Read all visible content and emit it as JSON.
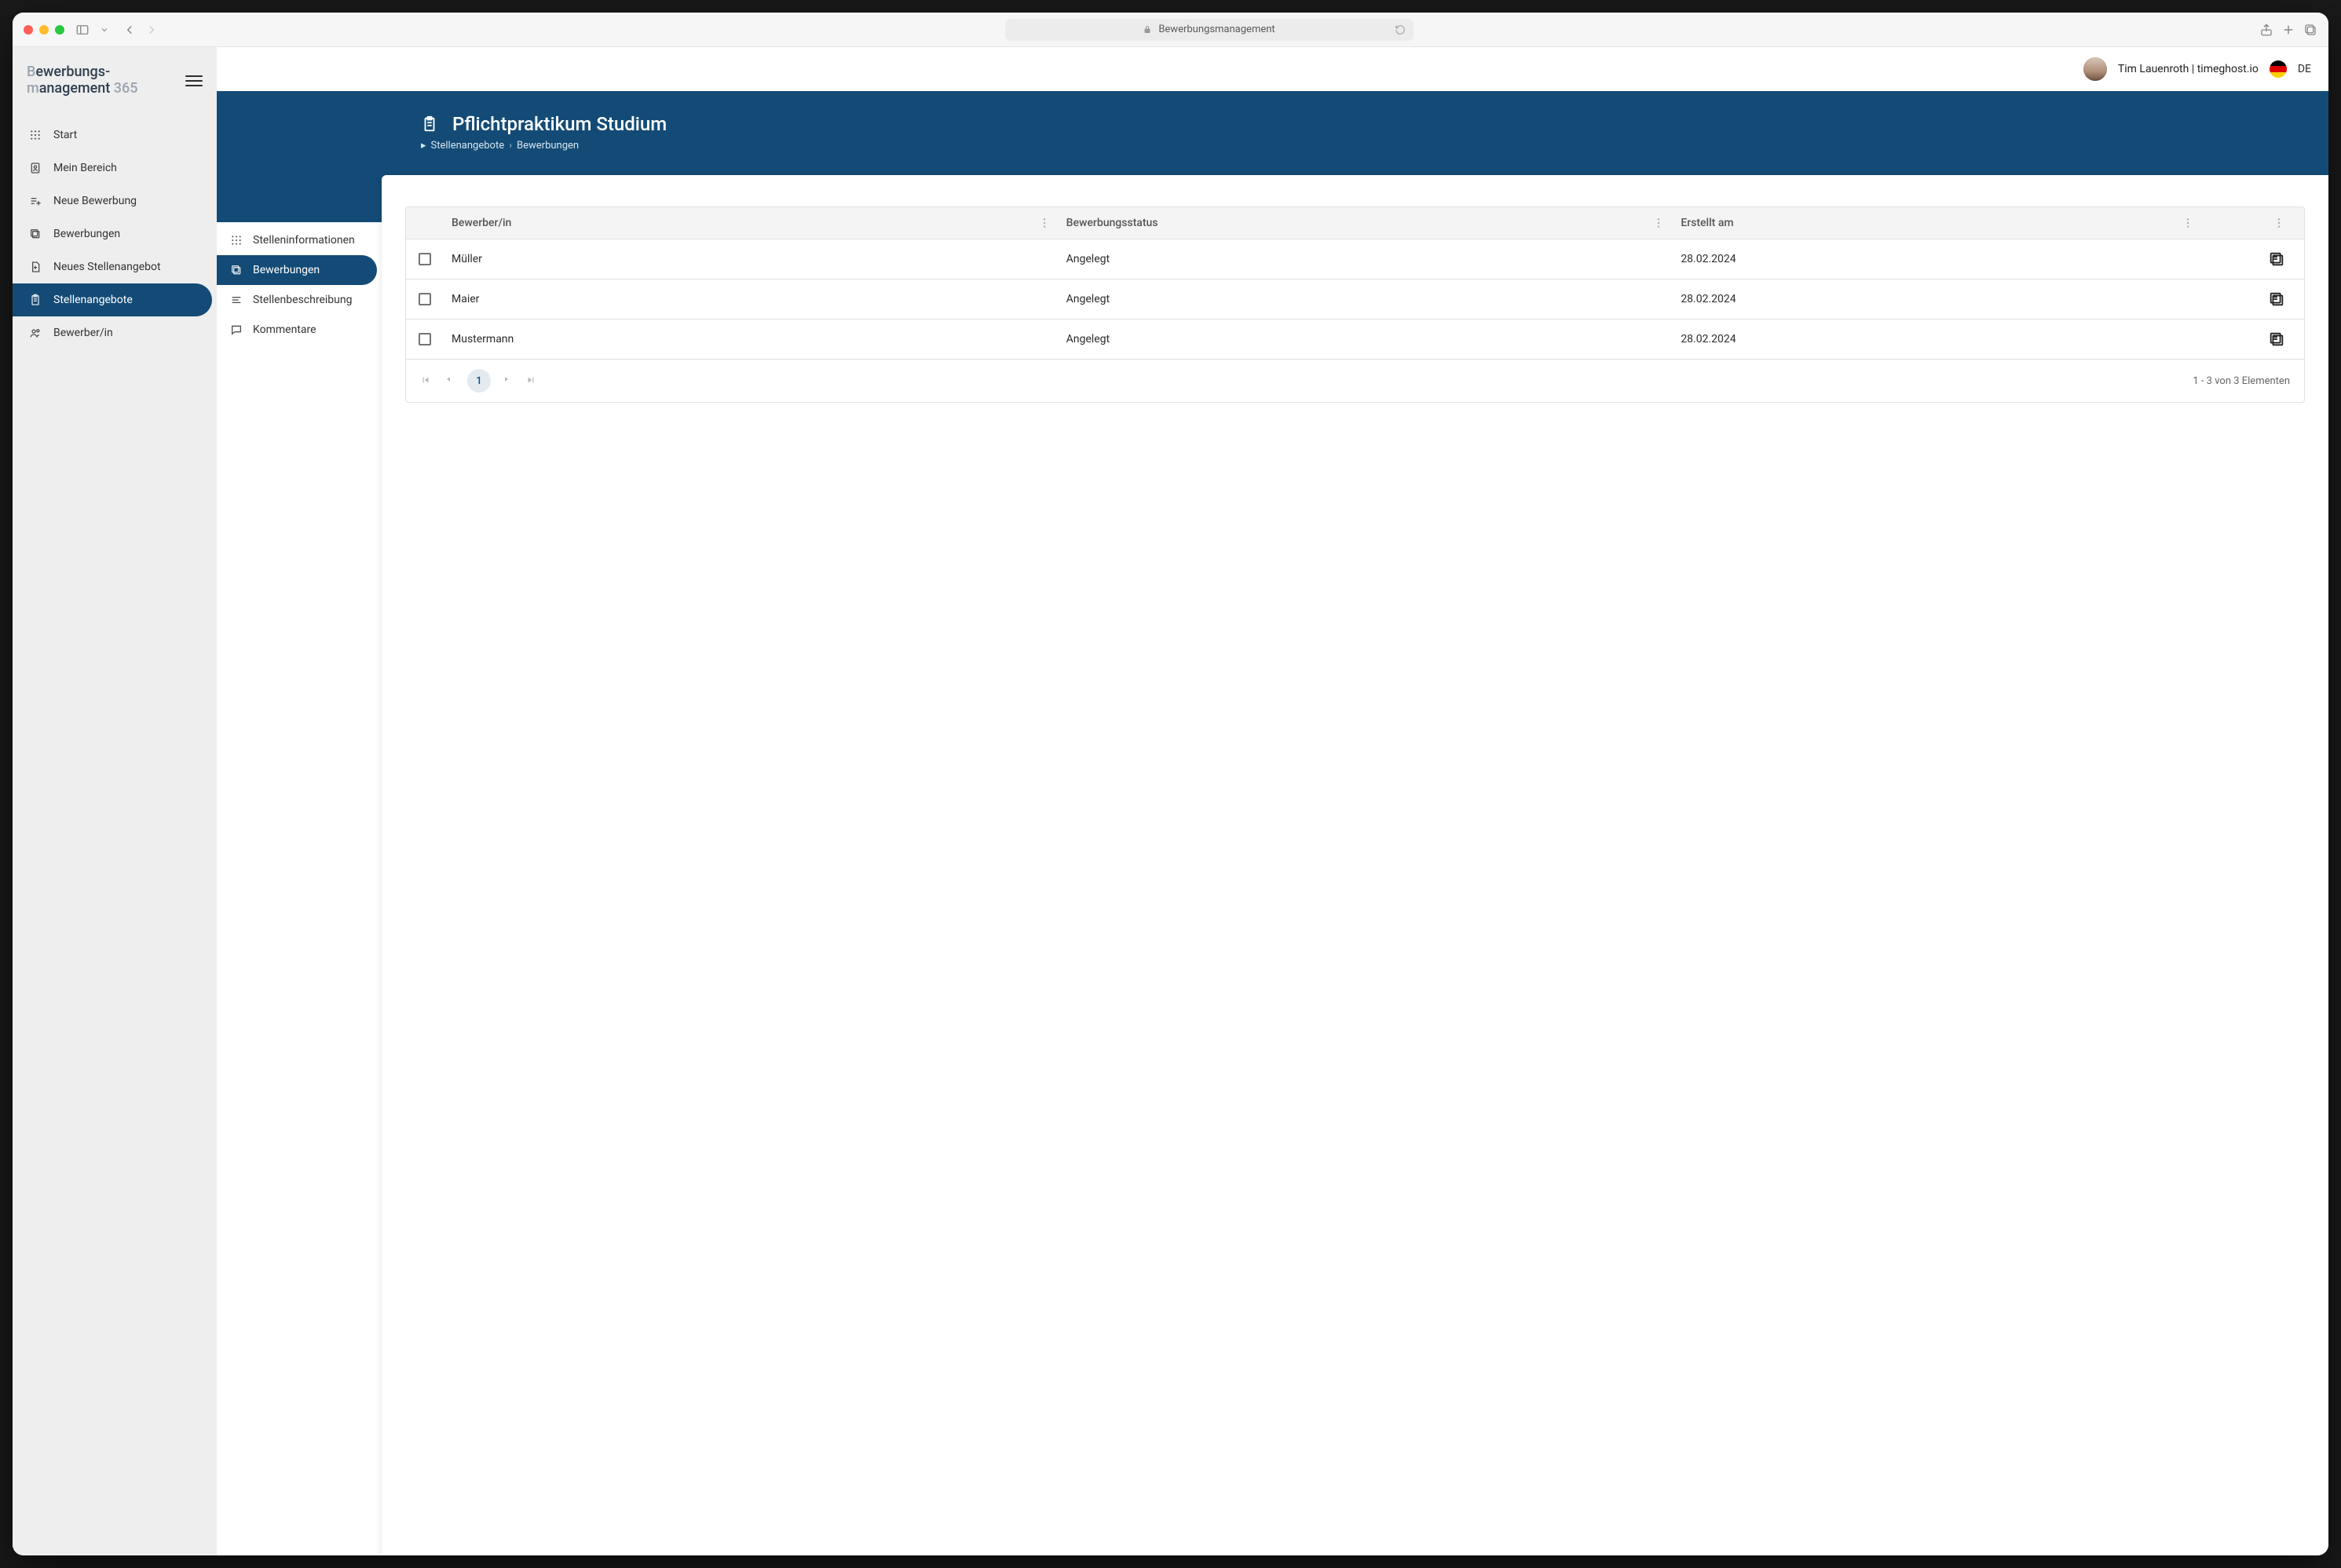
{
  "browser": {
    "url_label": "Bewerbungsmanagement"
  },
  "brand": {
    "line1_prefix_faded": "B",
    "line1_rest": "ewerbungs-",
    "line2_prefix_faded": "m",
    "line2_rest": "anagement",
    "suffix_faded": " 365"
  },
  "user": {
    "label": "Tim Lauenroth | timeghost.io",
    "locale_code": "DE"
  },
  "sidebar": {
    "items": [
      {
        "label": "Start"
      },
      {
        "label": "Mein Bereich"
      },
      {
        "label": "Neue Bewerbung"
      },
      {
        "label": "Bewerbungen"
      },
      {
        "label": "Neues Stellenangebot"
      },
      {
        "label": "Stellenangebote"
      },
      {
        "label": "Bewerber/in"
      }
    ]
  },
  "hero": {
    "title": "Pflichtpraktikum Studium",
    "breadcrumb": [
      "Stellenangebote",
      "Bewerbungen"
    ]
  },
  "subnav": {
    "items": [
      {
        "label": "Stelleninformationen"
      },
      {
        "label": "Bewerbungen"
      },
      {
        "label": "Stellenbeschreibung"
      },
      {
        "label": "Kommentare"
      }
    ]
  },
  "table": {
    "columns": {
      "name": "Bewerber/in",
      "status": "Bewerbungsstatus",
      "date": "Erstellt am"
    },
    "rows": [
      {
        "name": "Müller",
        "status": "Angelegt",
        "date": "28.02.2024"
      },
      {
        "name": "Maier",
        "status": "Angelegt",
        "date": "28.02.2024"
      },
      {
        "name": "Mustermann",
        "status": "Angelegt",
        "date": "28.02.2024"
      }
    ],
    "pager": {
      "current": "1",
      "summary": "1 - 3 von 3 Elementen"
    }
  },
  "colors": {
    "brand_dark": "#134b76"
  }
}
